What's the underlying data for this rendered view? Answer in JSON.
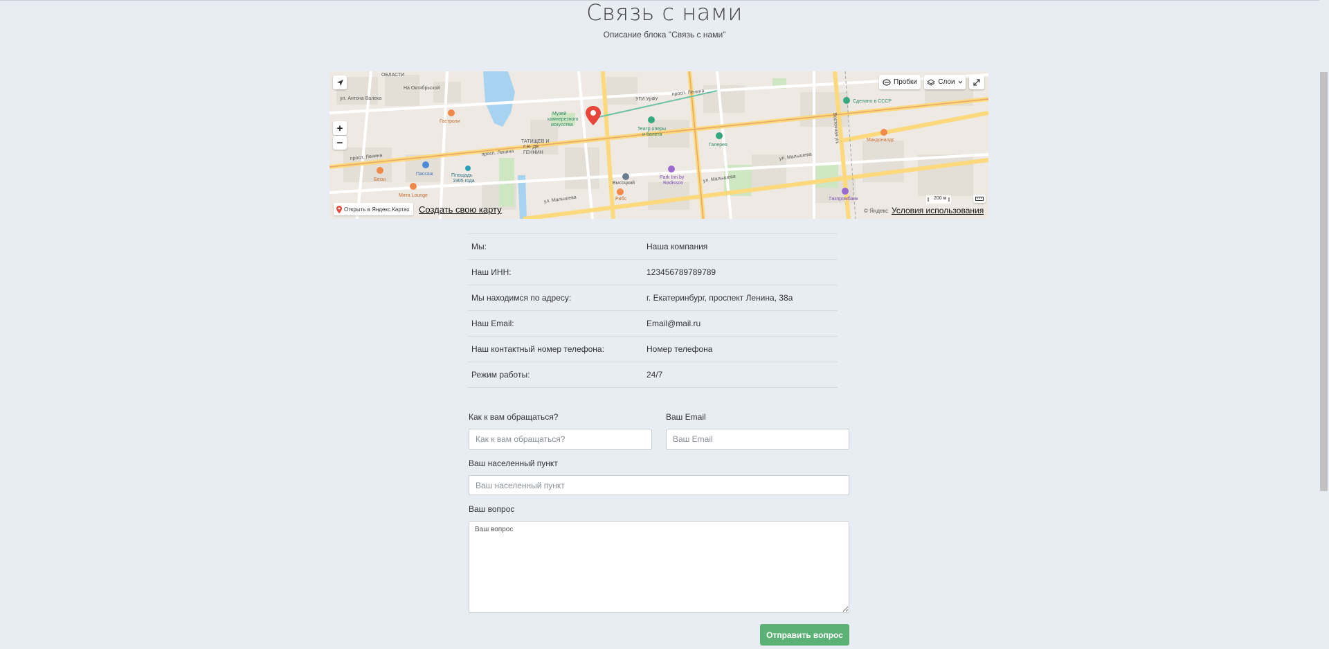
{
  "header": {
    "title": "Связь с нами",
    "subtitle": "Описание блока \"Связь с нами\""
  },
  "map": {
    "traffic_label": "Пробки",
    "layers_label": "Слои",
    "open_in_yandex_label": "Открыть в Яндекс.Картах",
    "create_map_link": "Создать свою карту",
    "terms_link": "Условия использования",
    "copyright": "© Яндекс",
    "scale": "200 м",
    "places": [
      {
        "name": "ул. Антона Валека"
      },
      {
        "name": "Гастроли"
      },
      {
        "name": "Музей камнерезного искусства"
      },
      {
        "name": "Театр оперы и балета"
      },
      {
        "name": "Галерея"
      },
      {
        "name": "Пассаж"
      },
      {
        "name": "Площадь 1905 года"
      },
      {
        "name": "Бесы"
      },
      {
        "name": "Мята Lounge"
      },
      {
        "name": "Высоцкий"
      },
      {
        "name": "Park Inn by Radisson"
      },
      {
        "name": "Рибс"
      },
      {
        "name": "Газпромбанк"
      },
      {
        "name": "Макдоналдс"
      },
      {
        "name": "Сделано в СССР"
      },
      {
        "name": "просп. Ленина"
      },
      {
        "name": "ул. Малышева"
      },
      {
        "name": "Восточная ул."
      },
      {
        "name": "УГИ УрФУ"
      }
    ]
  },
  "info": {
    "rows": [
      {
        "label": "Мы:",
        "value": "Наша компания"
      },
      {
        "label": "Наш ИНН:",
        "value": "123456789789789"
      },
      {
        "label": "Мы находимся по адресу:",
        "value": "г. Екатеринбург, проспект Ленина, 38а"
      },
      {
        "label": "Наш Email:",
        "value": "Email@mail.ru"
      },
      {
        "label": "Наш контактный номер телефона:",
        "value": "Номер телефона"
      },
      {
        "label": "Режим работы:",
        "value": "24/7"
      }
    ]
  },
  "form": {
    "name_label": "Как к вам обращаться?",
    "name_placeholder": "Как к вам обращаться?",
    "email_label": "Ваш Email",
    "email_placeholder": "Ваш Email",
    "city_label": "Ваш населенный пункт",
    "city_placeholder": "Ваш населенный пункт",
    "question_label": "Ваш вопрос",
    "question_placeholder": "Ваш вопрос",
    "submit_label": "Отправить вопрос"
  },
  "colors": {
    "background": "#e8edf4",
    "submit": "#5cb176",
    "marker": "#e8463b"
  }
}
